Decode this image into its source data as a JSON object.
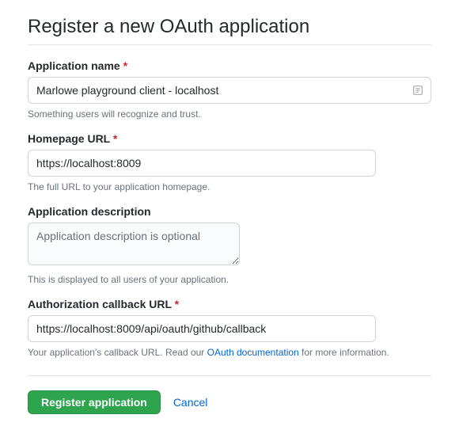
{
  "title": "Register a new OAuth application",
  "fields": {
    "app_name": {
      "label": "Application name",
      "required_marker": "*",
      "value": "Marlowe playground client - localhost",
      "help": "Something users will recognize and trust."
    },
    "homepage_url": {
      "label": "Homepage URL",
      "required_marker": "*",
      "value": "https://localhost:8009",
      "help": "The full URL to your application homepage."
    },
    "app_desc": {
      "label": "Application description",
      "placeholder": "Application description is optional",
      "help": "This is displayed to all users of your application."
    },
    "callback_url": {
      "label": "Authorization callback URL",
      "required_marker": "*",
      "value": "https://localhost:8009/api/oauth/github/callback",
      "help_prefix": "Your application's callback URL. Read our ",
      "help_link_text": "OAuth documentation",
      "help_suffix": " for more information."
    }
  },
  "actions": {
    "submit": "Register application",
    "cancel": "Cancel"
  }
}
